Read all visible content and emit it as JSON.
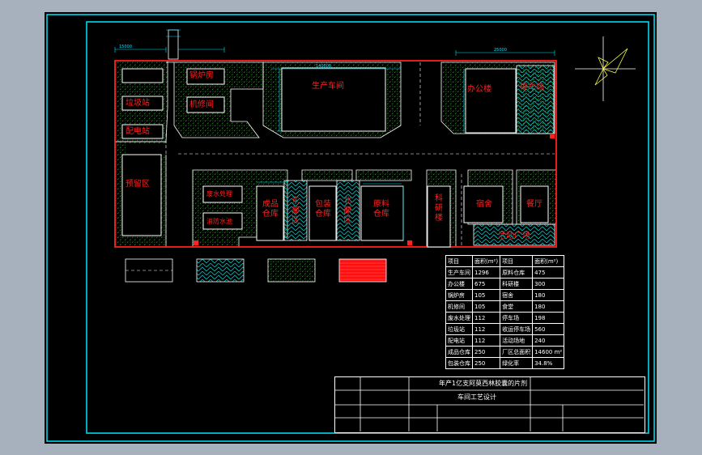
{
  "colors": {
    "background": "#a7b0bd",
    "canvas": "#000000",
    "frame": "#00e5ff",
    "boundary": "#ff2020",
    "lines": "#ffffff",
    "green_hatch": "#3c8a3c",
    "cyan_hatch": "#00c0c0"
  },
  "buildings": {
    "boiler_room": "锅炉房",
    "garbage_station": "垃圾站",
    "power_station": "配电站",
    "machine_room": "机修间",
    "production_workshop": "生产车间",
    "office_building": "办公楼",
    "parking_lot": "停车场",
    "reserve_area": "预留区",
    "water_treatment": "废水处理",
    "fire_pool": "消防水池",
    "product_warehouse": "成品仓库",
    "east_area": "东部区",
    "packaging_warehouse": "包装仓库",
    "north_area": "北部区",
    "raw_material_warehouse": "原料仓库",
    "research_building": "科研楼",
    "dormitory": "宿舍",
    "canteen": "餐厅",
    "activity_square": "活动广场"
  },
  "annotations": {
    "workshop_width": "140000",
    "office_width": "25000",
    "boiler_width": "15000"
  },
  "area_table": {
    "headers": [
      "项目",
      "面积(m²)",
      "项目",
      "面积(m²)"
    ],
    "rows": [
      [
        "生产车间",
        "1296",
        "原料仓库",
        "475"
      ],
      [
        "办公楼",
        "675",
        "科研楼",
        "300"
      ],
      [
        "锅炉房",
        "105",
        "宿舍",
        "180"
      ],
      [
        "机修间",
        "105",
        "食堂",
        "180"
      ],
      [
        "废水处理",
        "112",
        "停车场",
        "198"
      ],
      [
        "垃圾站",
        "112",
        "收运停车场",
        "560"
      ],
      [
        "配电站",
        "112",
        "活动场地",
        "240"
      ],
      [
        "成品仓库",
        "250",
        "厂区总面积",
        "14600 m²"
      ],
      [
        "包装仓库",
        "250",
        "绿化率",
        "34.8%"
      ]
    ]
  },
  "title_block": {
    "project_title": "年产1亿支阿莫西林胶囊的片剂",
    "drawing_name": "车间工艺设计"
  }
}
